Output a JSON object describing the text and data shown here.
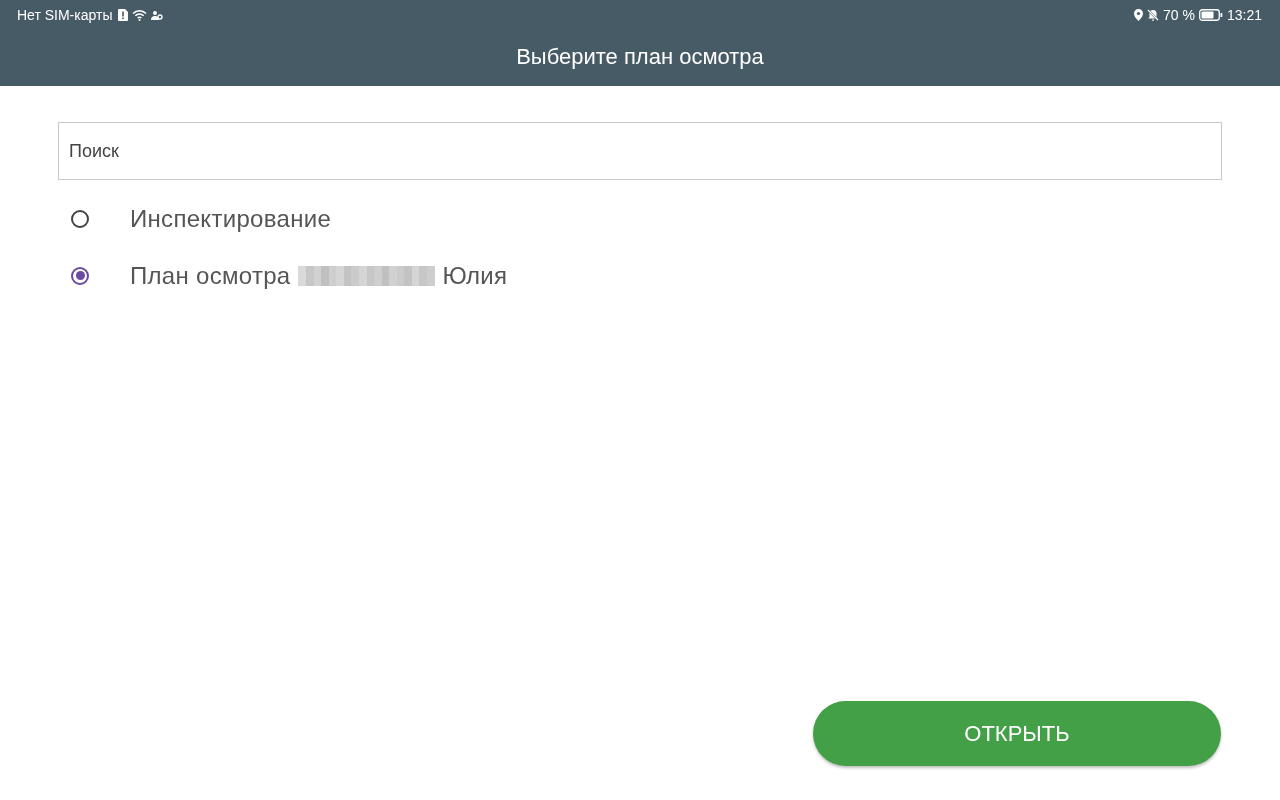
{
  "status_bar": {
    "carrier": "Нет SIM-карты",
    "battery": "70 %",
    "time": "13:21"
  },
  "header": {
    "title": "Выберите план осмотра"
  },
  "search": {
    "placeholder": "Поиск"
  },
  "options": [
    {
      "label": "Инспектирование",
      "selected": false
    },
    {
      "label": "План осмотра",
      "redacted": true,
      "label_after": "Юлия",
      "selected": true
    }
  ],
  "button": "ОТКРЫТЬ"
}
